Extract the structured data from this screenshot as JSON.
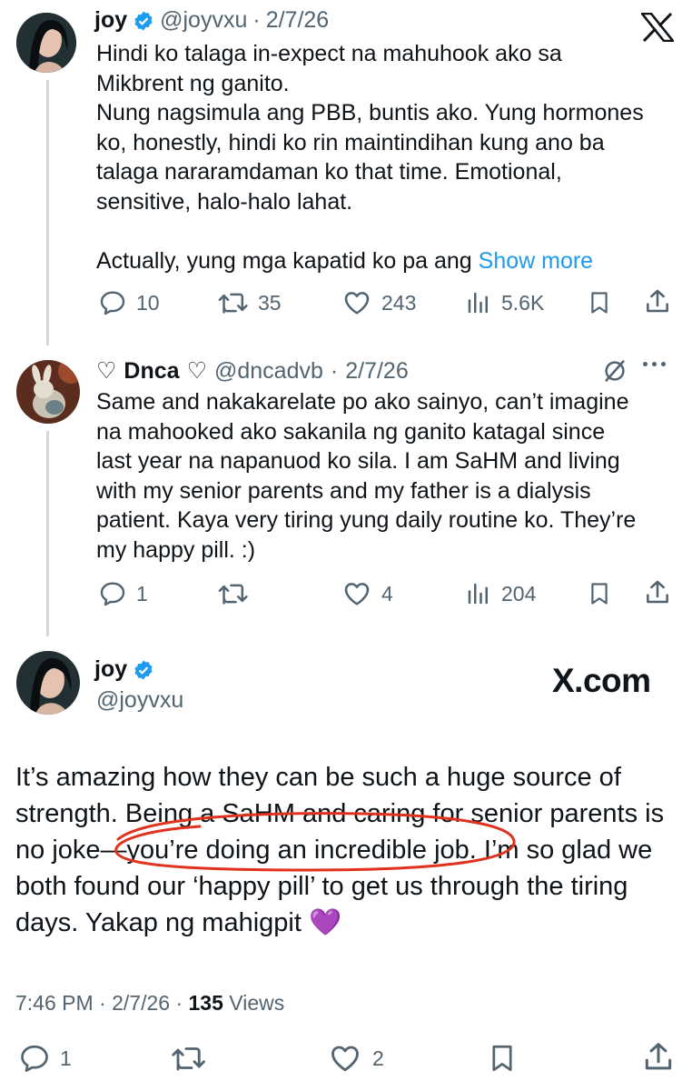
{
  "tweet1": {
    "name": "joy",
    "handle": "@joyvxu",
    "date": "2/7/26",
    "text_lines": [
      "Hindi ko talaga in-expect na mahuhook ako sa",
      "Mikbrent ng ganito.",
      "Nung nagsimula ang PBB, buntis ako. Yung hormones",
      "ko, honestly, hindi ko rin maintindihan kung ano ba",
      "talaga nararamdaman ko that time. Emotional,",
      "sensitive, halo-halo lahat."
    ],
    "last_line": "Actually, yung mga kapatid ko pa ang",
    "show_more": "Show more",
    "replies": "10",
    "reposts": "35",
    "likes": "243",
    "views": "5.6K",
    "colors": {
      "verified": "#1d9bf0",
      "link": "#1d9bf0"
    }
  },
  "tweet2": {
    "name_prefix": "♡",
    "name": "Dnca",
    "name_suffix": "♡",
    "handle": "@dncadvb",
    "date": "2/7/26",
    "text_lines": [
      "Same and nakakarelate po ako sainyo, can’t imagine",
      "na mahooked ako sakanila ng ganito katagal since",
      "last year na napanuod ko sila. I am SaHM and living",
      "with my senior parents and my father is a dialysis",
      "patient. Kaya very tiring yung daily routine ko. They’re",
      "my happy pill. :)"
    ],
    "replies": "1",
    "reposts": "",
    "likes": "4",
    "views": "204"
  },
  "tweet3": {
    "name": "joy",
    "handle": "@joyvxu",
    "watermark": "X.com",
    "text_lines": [
      "It’s amazing how they can be such a huge source of",
      "strength. Being a SaHM and caring for senior parents is",
      "no joke—you’re doing an incredible job. I’m so glad we",
      "both found our ‘happy pill’ to get us through the tiring",
      "days. Yakap ng mahigpit 💜"
    ],
    "time": "7:46 PM",
    "date": "2/7/26",
    "views_count": "135",
    "views_label": "Views",
    "replies": "1",
    "likes": "2",
    "colors": {
      "annotation": "#e0321c"
    }
  }
}
